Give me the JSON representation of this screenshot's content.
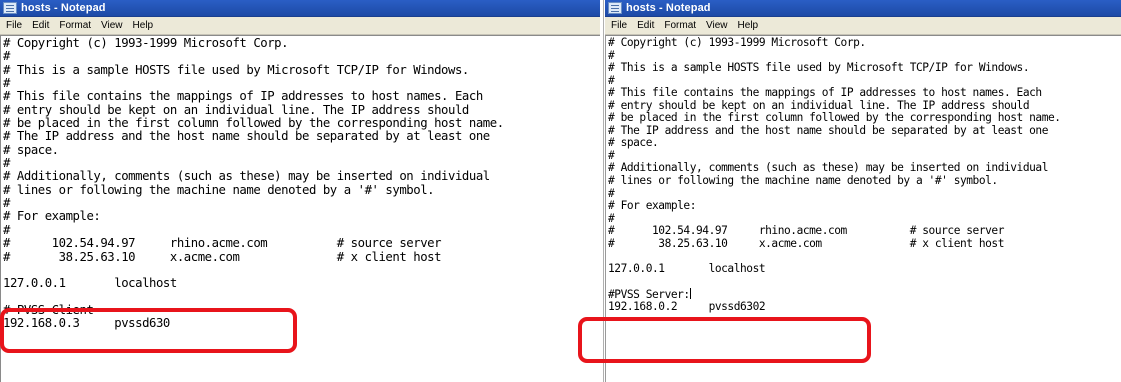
{
  "colors": {
    "titlebar": "#2a5ec5",
    "menubar": "#ece9d8",
    "highlight": "#e8141b"
  },
  "left": {
    "title": "hosts - Notepad",
    "menu": [
      "File",
      "Edit",
      "Format",
      "View",
      "Help"
    ],
    "lines": [
      "# Copyright (c) 1993-1999 Microsoft Corp.",
      "#",
      "# This is a sample HOSTS file used by Microsoft TCP/IP for Windows.",
      "#",
      "# This file contains the mappings of IP addresses to host names. Each",
      "# entry should be kept on an individual line. The IP address should",
      "# be placed in the first column followed by the corresponding host name.",
      "# The IP address and the host name should be separated by at least one",
      "# space.",
      "#",
      "# Additionally, comments (such as these) may be inserted on individual",
      "# lines or following the machine name denoted by a '#' symbol.",
      "#",
      "# For example:",
      "#",
      "#      102.54.94.97     rhino.acme.com          # source server",
      "#       38.25.63.10     x.acme.com              # x client host",
      "",
      "127.0.0.1       localhost",
      "",
      "# PVSS Client",
      "192.168.0.3     pvssd630"
    ]
  },
  "right": {
    "title": "hosts - Notepad",
    "menu": [
      "File",
      "Edit",
      "Format",
      "View",
      "Help"
    ],
    "lines": [
      "# Copyright (c) 1993-1999 Microsoft Corp.",
      "#",
      "# This is a sample HOSTS file used by Microsoft TCP/IP for Windows.",
      "#",
      "# This file contains the mappings of IP addresses to host names. Each",
      "# entry should be kept on an individual line. The IP address should",
      "# be placed in the first column followed by the corresponding host name.",
      "# The IP address and the host name should be separated by at least one",
      "# space.",
      "#",
      "# Additionally, comments (such as these) may be inserted on individual",
      "# lines or following the machine name denoted by a '#' symbol.",
      "#",
      "# For example:",
      "#",
      "#      102.54.94.97     rhino.acme.com          # source server",
      "#       38.25.63.10     x.acme.com              # x client host",
      "",
      "127.0.0.1       localhost",
      "",
      "#PVSS Server:",
      "192.168.0.2     pvssd6302"
    ]
  }
}
